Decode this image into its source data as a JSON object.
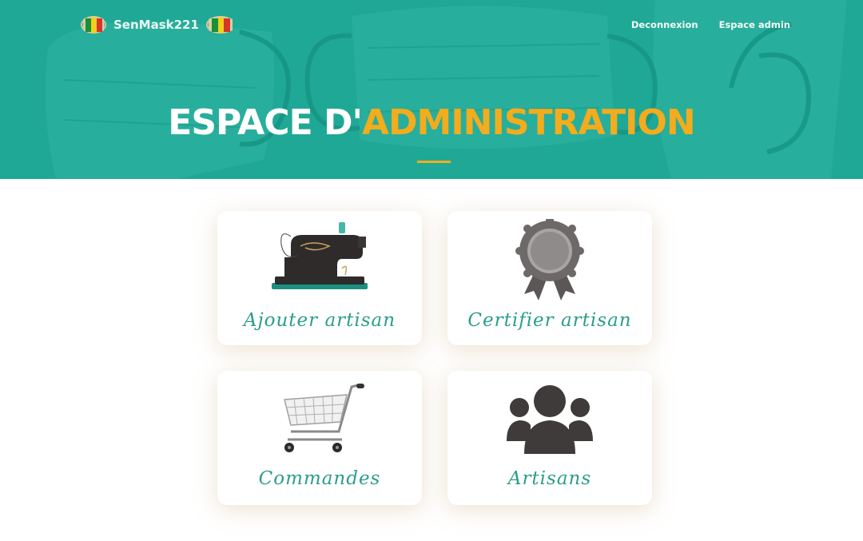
{
  "header": {
    "brand": "SenMask221",
    "nav": {
      "logout": "Deconnexion",
      "admin": "Espace admin"
    },
    "title_part1": "ESPACE D'",
    "title_part2": "ADMINISTRATION"
  },
  "cards": [
    {
      "label": "Ajouter artisan",
      "icon": "sewing-machine-icon"
    },
    {
      "label": "Certifier artisan",
      "icon": "award-badge-icon"
    },
    {
      "label": "Commandes",
      "icon": "shopping-cart-icon"
    },
    {
      "label": "Artisans",
      "icon": "people-group-icon"
    }
  ],
  "colors": {
    "teal": "#1fa896",
    "accent_yellow": "#f2ac1d",
    "label_teal": "#2a9d8c",
    "icon_dark": "#3f3b3b"
  }
}
